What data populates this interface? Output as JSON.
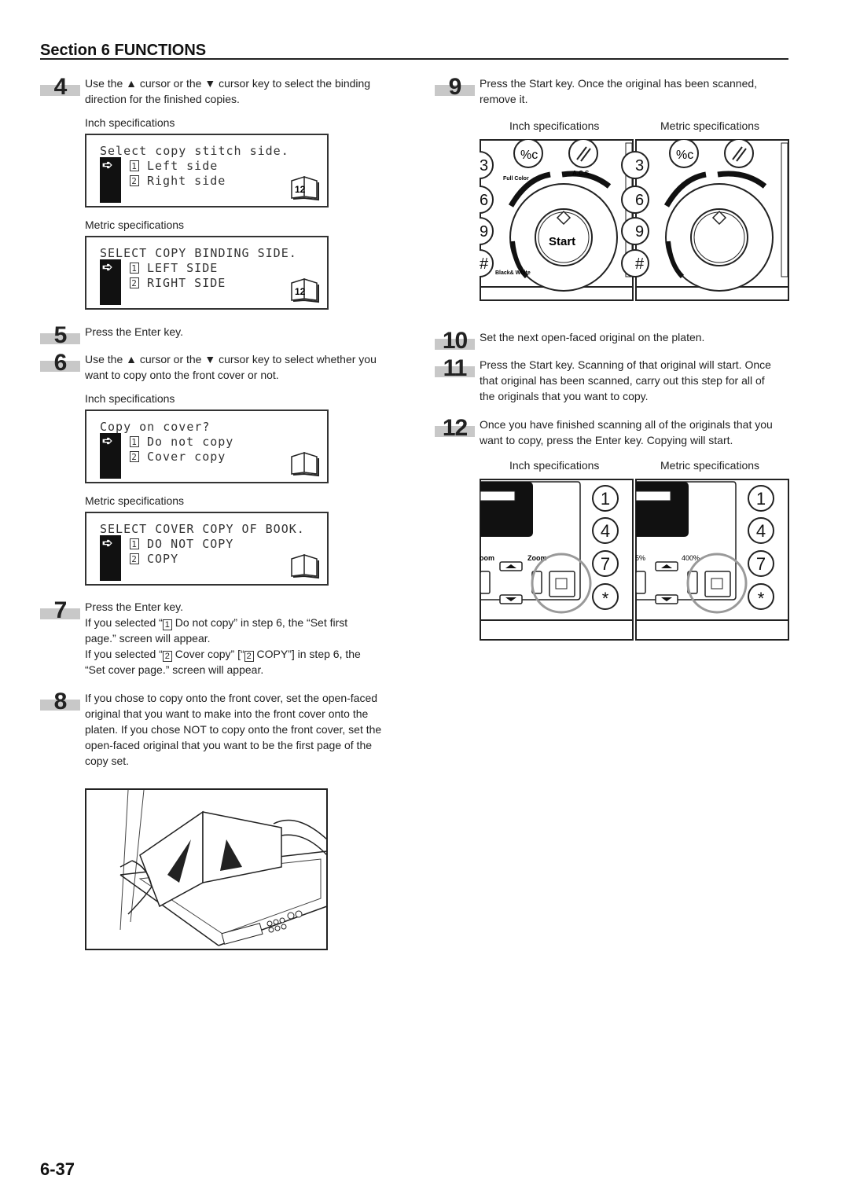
{
  "header": {
    "section": "Section 6  FUNCTIONS"
  },
  "page_number": "6-37",
  "steps": {
    "s4": {
      "num": "4",
      "lines": [
        "Use the ▲ cursor or the ▼ cursor key to select the binding",
        "direction for the finished copies."
      ],
      "inch_caption": "Inch specifications",
      "metric_caption": "Metric specifications",
      "inch_lcd": {
        "title": "Select copy stitch side.",
        "opt1": "Left side",
        "opt2": "Right side"
      },
      "metric_lcd": {
        "title": "SELECT COPY BINDING SIDE.",
        "opt1": "LEFT SIDE",
        "opt2": "RIGHT SIDE"
      },
      "book_icon_label": "12"
    },
    "s5": {
      "num": "5",
      "lines": [
        "Press the Enter key."
      ]
    },
    "s6": {
      "num": "6",
      "lines": [
        "Use the ▲ cursor or the ▼ cursor key to select whether you",
        "want to copy onto the front cover or not."
      ],
      "inch_caption": "Inch specifications",
      "metric_caption": "Metric specifications",
      "inch_lcd": {
        "title": "Copy on cover?",
        "opt1": "Do not copy",
        "opt2": "Cover copy"
      },
      "metric_lcd": {
        "title": "SELECT COVER COPY OF BOOK.",
        "opt1": "DO NOT COPY",
        "opt2": "COPY"
      }
    },
    "s7": {
      "num": "7",
      "line1": "Press the Enter key.",
      "l2a": "If you selected “",
      "l2b": " Do not copy” in step 6, the “Set first",
      "l3": "page.” screen will appear.",
      "l4a": "If you selected “",
      "l4b": " Cover copy” [“",
      "l4c": " COPY”] in step 6, the",
      "l5": "“Set cover page.” screen will appear.",
      "k1": "1",
      "k2": "2"
    },
    "s8": {
      "num": "8",
      "lines": [
        "If you chose to copy onto the front cover, set the open-faced",
        "original that you want to make into the front cover onto the",
        "platen. If you chose NOT to copy onto the front cover, set the",
        "open-faced original that you want to be the first page of the",
        "copy set."
      ]
    },
    "s9": {
      "num": "9",
      "lines": [
        "Press the Start key. Once the original has been scanned,",
        "remove it."
      ],
      "inch_caption": "Inch specifications",
      "metric_caption": "Metric specifications",
      "panel": {
        "full_color": "Full Color",
        "acs": "A.C.S.",
        "start": "Start",
        "bw": "Black& White",
        "keys": [
          "3",
          "6",
          "9",
          "#"
        ]
      }
    },
    "s10": {
      "num": "10",
      "lines": [
        "Set the next open-faced original on the platen."
      ]
    },
    "s11": {
      "num": "11",
      "lines": [
        "Press the Start key. Scanning of that original will start. Once",
        "that original has been scanned, carry out this step for all of",
        "the originals that you want to copy."
      ]
    },
    "s12": {
      "num": "12",
      "lines": [
        "Once you have finished scanning all of the originals that you",
        "want to copy, press the Enter key. Copying will start."
      ],
      "inch_caption": "Inch specifications",
      "metric_caption": "Metric specifications",
      "panel": {
        "inch_left": "oom",
        "inch_right": "Zoom",
        "metric_left": "5%",
        "metric_right": "400%",
        "keys": [
          "1",
          "4",
          "7",
          "*"
        ]
      }
    }
  },
  "colors": {
    "step_bar": "#c8c8c8",
    "highlight_circle": "#999999"
  }
}
